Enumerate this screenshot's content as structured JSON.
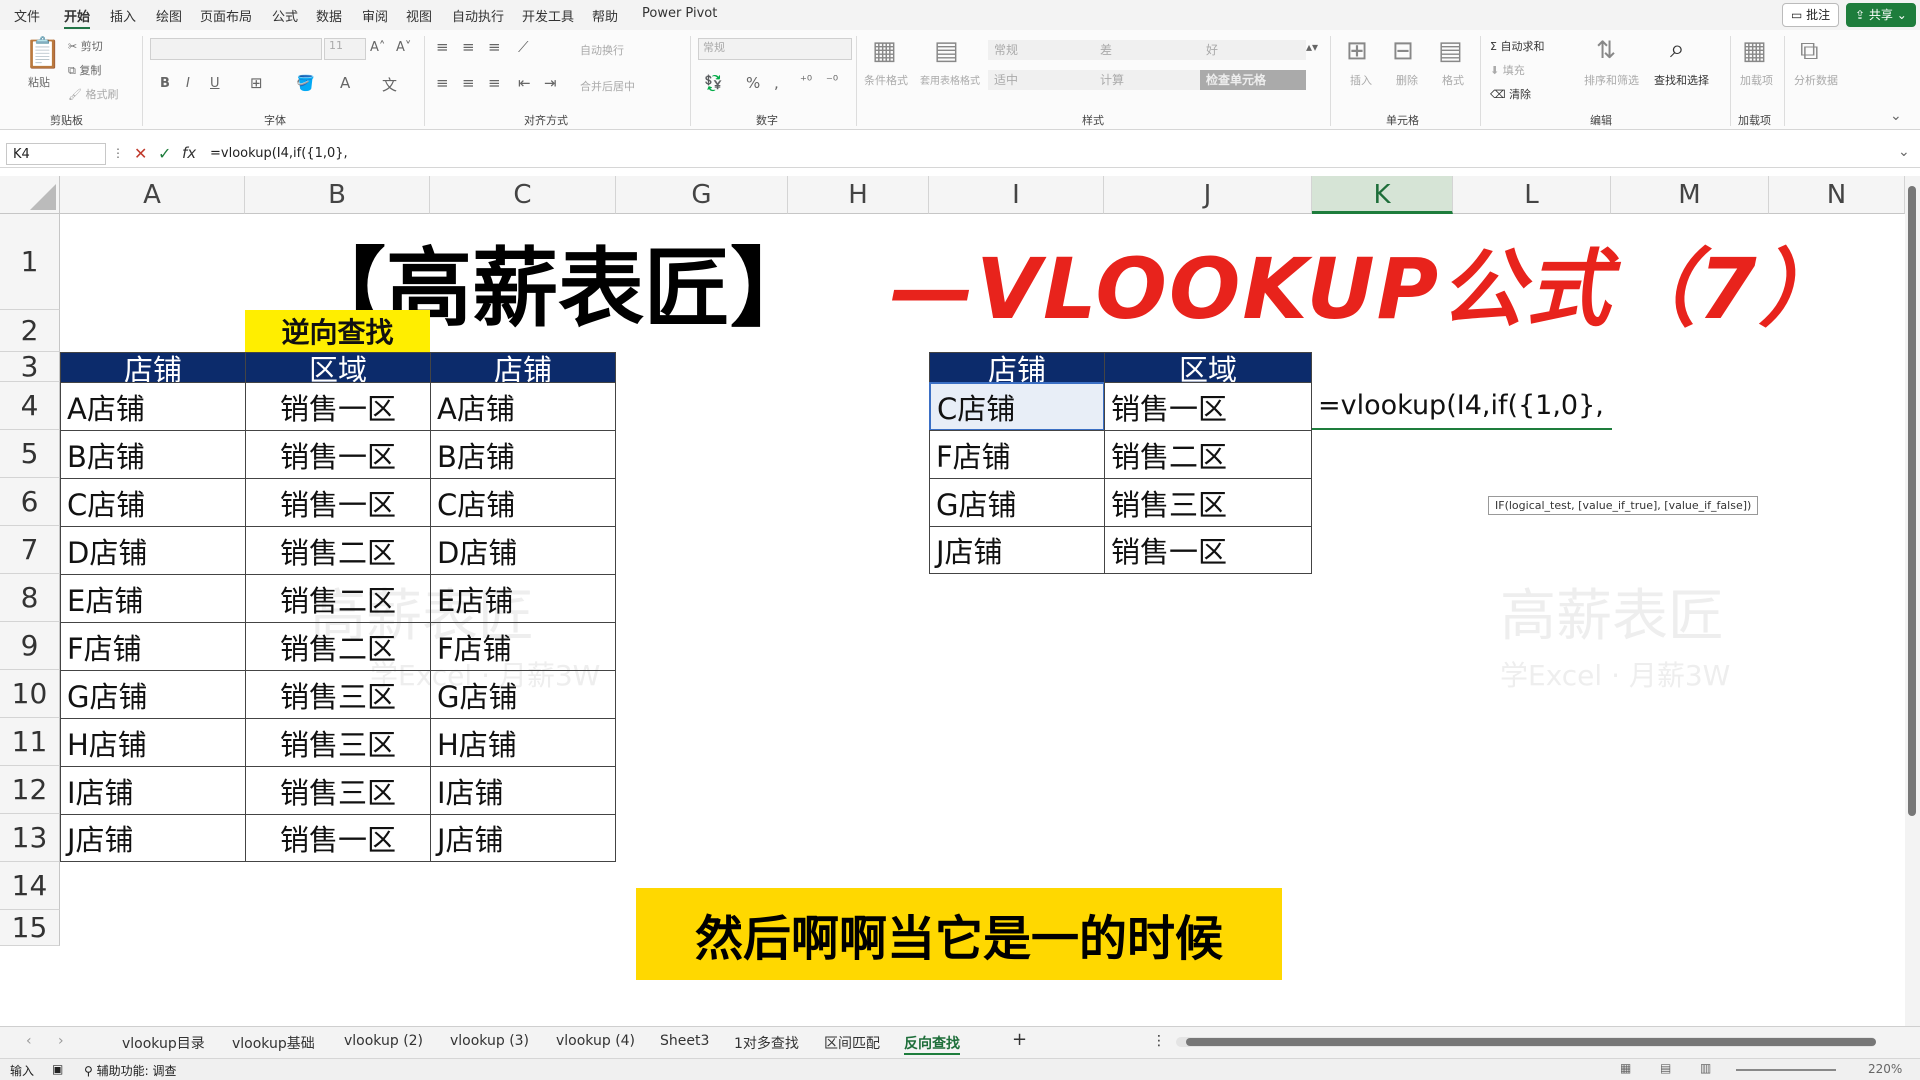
{
  "menu": {
    "items": [
      "文件",
      "开始",
      "插入",
      "绘图",
      "页面布局",
      "公式",
      "数据",
      "审阅",
      "视图",
      "自动执行",
      "开发工具",
      "帮助",
      "Power Pivot"
    ],
    "active_index": 1,
    "comments_label": "批注",
    "share_label": "共享"
  },
  "ribbon": {
    "clipboard": {
      "paste": "粘贴",
      "cut": "剪切",
      "copy": "复制",
      "format_painter": "格式刷",
      "group": "剪贴板"
    },
    "font": {
      "font_size": "11",
      "group": "字体",
      "bold": "B",
      "italic": "I",
      "underline": "U"
    },
    "alignment": {
      "wrap": "自动换行",
      "merge": "合并后居中",
      "group": "对齐方式"
    },
    "number": {
      "format": "常规",
      "group": "数字",
      "percent": "%",
      "comma": ","
    },
    "styles": {
      "conditional": "条件格式",
      "table": "套用表格格式",
      "normal": "常规",
      "bad": "差",
      "good": "好",
      "neutral": "适中",
      "calc": "计算",
      "check": "检查单元格",
      "group": "样式"
    },
    "cells": {
      "insert": "插入",
      "delete": "删除",
      "format": "格式",
      "group": "单元格"
    },
    "editing": {
      "autosum": "自动求和",
      "fill": "填充",
      "clear": "清除",
      "sort": "排序和筛选",
      "find": "查找和选择",
      "group": "编辑"
    },
    "addins": {
      "addin": "加载项",
      "addin_label": "加载项",
      "analyze": "分析数据"
    }
  },
  "formula_bar": {
    "name_box": "K4",
    "formula": "=vlookup(I4,if({1,0},"
  },
  "columns": [
    "A",
    "B",
    "C",
    "G",
    "H",
    "I",
    "J",
    "K",
    "L",
    "M",
    "N"
  ],
  "rows": [
    "1",
    "2",
    "3",
    "4",
    "5",
    "6",
    "7",
    "8",
    "9",
    "10",
    "11",
    "12",
    "13",
    "14",
    "15"
  ],
  "title": {
    "left": "【高薪表匠】",
    "right": "—VLOOKUP公式（7）"
  },
  "label_reverse": "逆向查找",
  "left_table": {
    "headers": [
      "店铺",
      "区域",
      "店铺"
    ],
    "rows": [
      [
        "A店铺",
        "销售一区",
        "A店铺"
      ],
      [
        "B店铺",
        "销售一区",
        "B店铺"
      ],
      [
        "C店铺",
        "销售一区",
        "C店铺"
      ],
      [
        "D店铺",
        "销售二区",
        "D店铺"
      ],
      [
        "E店铺",
        "销售二区",
        "E店铺"
      ],
      [
        "F店铺",
        "销售二区",
        "F店铺"
      ],
      [
        "G店铺",
        "销售三区",
        "G店铺"
      ],
      [
        "H店铺",
        "销售三区",
        "H店铺"
      ],
      [
        "I店铺",
        "销售三区",
        "I店铺"
      ],
      [
        "J店铺",
        "销售一区",
        "J店铺"
      ]
    ]
  },
  "right_table": {
    "headers": [
      "店铺",
      "区域"
    ],
    "rows": [
      [
        "C店铺",
        "销售一区"
      ],
      [
        "F店铺",
        "销售二区"
      ],
      [
        "G店铺",
        "销售三区"
      ],
      [
        "J店铺",
        "销售一区"
      ]
    ]
  },
  "editing_cell": "=vlookup(I4,if({1,0},",
  "tooltip": "IF(logical_test, [value_if_true], [value_if_false])",
  "subtitle": "然后啊啊当它是一的时候",
  "watermark": {
    "main": "高薪表匠",
    "sub": "学Excel · 月薪3W"
  },
  "sheets": [
    "vlookup目录",
    "vlookup基础",
    "vlookup (2)",
    "vlookup (3)",
    "vlookup (4)",
    "Sheet3",
    "1对多查找",
    "区间匹配",
    "反向查找"
  ],
  "active_sheet_index": 8,
  "status": {
    "mode": "输入",
    "accessibility": "辅助功能: 调查",
    "zoom": "220%"
  },
  "colors": {
    "accent": "#1e7d3c",
    "table_header": "#0c2b6b",
    "title_red": "#e8231c",
    "highlight": "#ffd800"
  }
}
